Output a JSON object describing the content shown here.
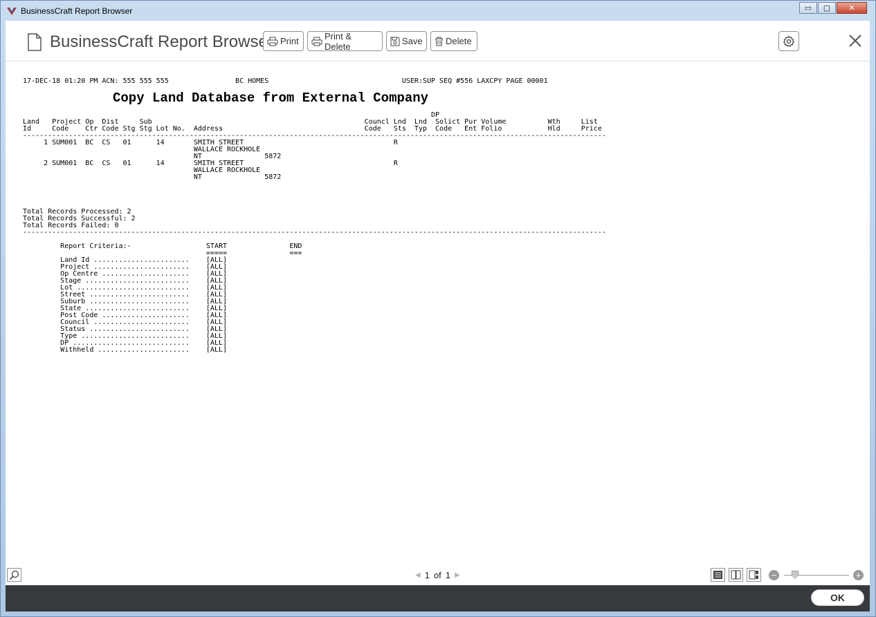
{
  "window": {
    "title": "BusinessCraft Report Browser",
    "buttons": {
      "minimize": "▭",
      "maximize": "▢",
      "close": "✕"
    }
  },
  "toolbar": {
    "title": "BusinessCraft Report Browser",
    "print_label": "Print",
    "print_delete_label": "Print & Delete",
    "save_label": "Save",
    "delete_label": "Delete"
  },
  "report": {
    "title": "Copy Land Database from External Company",
    "header_line": "17-DEC-18 01:20 PM ACN: 555 555 555                BC HOMES                                USER:SUP SEQ #556 LAXCPY PAGE 00001",
    "body": "\n\n\n\n\n                                                                                                  DP\nLand   Project Op  Dist     Sub                                                   Councl Lnd  Lnd  Solict Pur Volume          Wth     List\nId     Code    Ctr Code Stg Stg Lot No.  Address                                  Code   Sts  Typ  Code   Ent Folio           Hld     Price\n--------------------------------------------------------------------------------------------------------------------------------------------\n     1 SUM001  BC  CS   01      14       SMITH STREET                                    R\n                                         WALLACE ROCKHOLE\n                                         NT               5872\n     2 SUM001  BC  CS   01      14       SMITH STREET                                    R\n                                         WALLACE ROCKHOLE\n                                         NT               5872\n\n\n\n\nTotal Records Processed: 2\nTotal Records Successful: 2\nTotal Records Failed: 0\n--------------------------------------------------------------------------------------------------------------------------------------------\n\n         Report Criteria:-                  START               END\n                                            =====               ===\n         Land Id .......................    [ALL]\n         Project .......................    [ALL]\n         Op Centre .....................    [ALL]\n         Stage .........................    [ALL]\n         Lot ...........................    [ALL]\n         Street ........................    [ALL]\n         Suburb ........................    [ALL]\n         State .........................    [ALL]\n         Post Code .....................    [ALL]\n         Council .......................    [ALL]\n         Status ........................    [ALL]\n         Type ..........................    [ALL]\n         DP ............................    [ALL]\n         Withheld ......................    [ALL]"
  },
  "footer": {
    "page_current": "1",
    "page_of": "of",
    "page_total": "1",
    "ok_label": "OK"
  },
  "colors": {
    "frame": "#b9d1ea",
    "statusbar": "#36393e",
    "close_button": "#c9472e"
  },
  "icons": [
    "app-logo-icon",
    "document-icon",
    "printer-icon",
    "save-icon",
    "trash-icon",
    "gear-icon",
    "close-icon",
    "search-zoom-icon",
    "single-page-icon",
    "two-page-icon",
    "continuous-page-icon"
  ]
}
